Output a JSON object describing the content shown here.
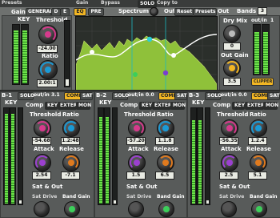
{
  "topbar": {
    "presets_label": "Presets",
    "gain_label": "Gain",
    "general_label": "GENERAL",
    "d_label": "D",
    "e_label": "E",
    "bypass_label": "Bypass",
    "solo_label": "SOLO",
    "copy_label": "Copy to"
  },
  "eq": {
    "eq_label": "EQ",
    "pre_label": "PRE",
    "spectrum_label": "Spectrum",
    "out_label": "Out",
    "reset_label": "Reset",
    "presets_label": "Presets"
  },
  "key": {
    "key_label": "KEY",
    "threshold_label": "Threshold",
    "threshold_value": "-24.00",
    "ratio_label": "Ratio",
    "ratio_value": "2.00:1"
  },
  "out": {
    "out_label": "Out",
    "bands_label": "Bands",
    "bands_value": "3",
    "dry_mix_label": "Dry Mix",
    "dry_mix_value": "0",
    "out_gain_label": "Out Gain",
    "out_gain_value": "3.5",
    "outin_label": "out/in",
    "outin_value": "1",
    "clipper_label": "CLIPPER"
  },
  "bands": [
    {
      "name": "B-1",
      "solo": "SOLO",
      "outin_label": "out/in",
      "outin_value": "3.1",
      "comp_on": "COMP",
      "sat_on": "SAT",
      "comp_tab": "Comp",
      "key_btn": "KEY",
      "extern_btn": "EXTERN",
      "mon_btn": "MON",
      "key_label": "KEY",
      "threshold_label": "Threshold",
      "threshold_value": "-54.68",
      "ratio_label": "Ratio",
      "ratio_value": "1.2:48",
      "attack_label": "Attack",
      "attack_value": "2.54",
      "release_label": "Release",
      "release_value": "-7.1",
      "satout_label": "Sat & Out",
      "satdrive_label": "Sat Drive",
      "bandgain_label": "Band Gain"
    },
    {
      "name": "B-2",
      "solo": "SOLO",
      "outin_label": "out/in",
      "outin_value": "0.0",
      "comp_on": "COMP",
      "sat_on": "SAT",
      "comp_tab": "Comp",
      "key_btn": "KEY",
      "extern_btn": "EXTERN",
      "mon_btn": "MON",
      "key_label": "KEY",
      "threshold_label": "Threshold",
      "threshold_value": "-57.20",
      "ratio_label": "Ratio",
      "ratio_value": "1.1.8",
      "attack_label": "Attack",
      "attack_value": "1.5",
      "release_label": "Release",
      "release_value": "6.5",
      "satout_label": "Sat & Out",
      "satdrive_label": "Sat Drive",
      "bandgain_label": "Band Gain"
    },
    {
      "name": "B-3",
      "solo": "SOLO",
      "outin_label": "out/in",
      "outin_value": "0.0",
      "comp_on": "COMP",
      "sat_on": "SAT",
      "comp_tab": "Comp",
      "key_btn": "KEY",
      "extern_btn": "EXTERN",
      "mon_btn": "MON",
      "key_label": "KEY",
      "threshold_label": "Threshold",
      "threshold_value": "-56.35",
      "ratio_label": "Ratio",
      "ratio_value": "1.2.4",
      "attack_label": "Attack",
      "attack_value": "2.5",
      "release_label": "Release",
      "release_value": "5.1",
      "satout_label": "Sat & Out",
      "satdrive_label": "Sat Drive",
      "bandgain_label": "Band Gain"
    }
  ],
  "colors": {
    "accent": "#f2b624",
    "threshold_knob": "#d63a8c",
    "ratio_knob": "#1a9ad6",
    "attack_knob": "#9b40d0",
    "release_knob": "#e07a1e",
    "meter_green": "#6ee24a",
    "clipper": "#f2b624"
  }
}
